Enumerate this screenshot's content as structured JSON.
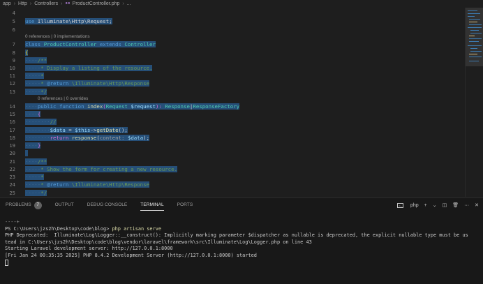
{
  "breadcrumb": {
    "items": [
      "app",
      "Http",
      "Controllers",
      "ProductController.php",
      "..."
    ],
    "file_icon": "php-file-icon"
  },
  "editor": {
    "line_numbers": [
      "4",
      "5",
      "6",
      "7",
      "8",
      "9",
      "10",
      "11",
      "12",
      "13",
      "14",
      "15",
      "16",
      "17",
      "18",
      "19",
      "20",
      "21",
      "22",
      "23",
      "24",
      "25"
    ],
    "code_lens_class": "0 references | 0 implementations",
    "code_lens_method": "0 references | 0 overrides",
    "lines": {
      "l5": [
        "use",
        "Illuminate\\Http\\Request",
        ";"
      ],
      "l7": [
        "class",
        "ProductController",
        "extends",
        "Controller"
      ],
      "l8": [
        "{"
      ],
      "l9": [
        "/**"
      ],
      "l10": [
        "* Display a listing of the resource."
      ],
      "l11": [
        "*"
      ],
      "l12": [
        "* ",
        "@return",
        " \\Illuminate\\Http\\Response"
      ],
      "l13": [
        "*/"
      ],
      "l14": [
        "public",
        "function",
        "index",
        "(",
        "Request",
        "$request",
        "): ",
        "Response",
        "|",
        "ResponseFactory"
      ],
      "l15": [
        "{"
      ],
      "l16": [
        "//"
      ],
      "l17": [
        "$data",
        " = ",
        "$this",
        "->",
        "getDate",
        "();"
      ],
      "l18": [
        "return",
        "response",
        "(",
        "content:",
        "$data",
        ");"
      ],
      "l19": [
        "}"
      ],
      "l21": [
        "/**"
      ],
      "l22": [
        "* Show the form for creating a new resource."
      ],
      "l23": [
        "*"
      ],
      "l24": [
        "* ",
        "@return",
        " \\Illuminate\\Http\\Response"
      ],
      "l25": [
        "*/"
      ]
    }
  },
  "panel": {
    "tabs": [
      {
        "label": "PROBLEMS",
        "badge": "7",
        "active": false
      },
      {
        "label": "OUTPUT",
        "active": false
      },
      {
        "label": "DEBUG CONSOLE",
        "active": false
      },
      {
        "label": "TERMINAL",
        "active": true
      },
      {
        "label": "PORTS",
        "active": false
      }
    ],
    "terminal_profile": "php",
    "actions": {
      "add": "+",
      "dropdown": "⌄",
      "split": "◫",
      "kill": "🗑",
      "more": "···",
      "close": "✕"
    }
  },
  "terminal": {
    "lines": [
      "----+",
      "PS C:\\Users\\jzs2h\\Desktop\\code\\blog> php artisan serve",
      "PHP Deprecated:  Illuminate\\Log\\Logger::__construct(): Implicitly marking parameter $dispatcher as nullable is deprecated, the explicit nullable type must be us",
      "tead in C:\\Users\\jzs2h\\Desktop\\code\\blog\\vendor\\laravel\\framework\\src\\Illuminate\\Log\\Logger.php on line 43",
      "Starting Laravel development server: http://127.0.0.1:8000",
      "[Fri Jan 24 00:35:35 2025] PHP 8.4.2 Development Server (http://127.0.0.1:8000) started"
    ],
    "prompt_prefix": "PS C:\\Users\\jzs2h\\Desktop\\code\\blog> ",
    "command": "php artisan serve"
  },
  "colors": {
    "editor_bg": "#1e1e1e",
    "panel_bg": "#181818",
    "selection": "#264f78",
    "keyword": "#569cd6",
    "type": "#4ec9b0",
    "comment": "#6a9955",
    "function": "#dcdcaa",
    "variable": "#9cdcfe"
  }
}
